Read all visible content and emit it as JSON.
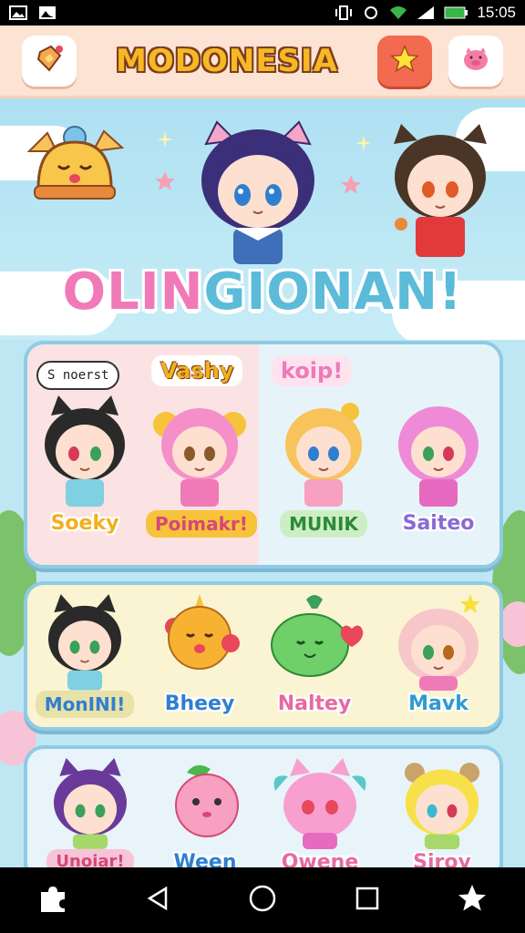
{
  "status_bar": {
    "time": "15:05"
  },
  "header": {
    "title": "MODONESIA",
    "left_button_icon": "map-pin-icon",
    "star_button_icon": "star-icon",
    "right_button_icon": "pig-icon"
  },
  "hero": {
    "title_part1": "OLIN",
    "title_part2": "GIONAN!"
  },
  "panel1": {
    "bubble_text": "S noerst",
    "banner_left": "Vashy",
    "banner_right": "koip!",
    "characters": [
      {
        "label": "Soeky"
      },
      {
        "label": "Poimakr!"
      },
      {
        "label": "MUNIK"
      },
      {
        "label": "Saiteo"
      }
    ]
  },
  "panel2": {
    "characters": [
      {
        "label": "MonINI!"
      },
      {
        "label": "Bheey"
      },
      {
        "label": "Naltey"
      },
      {
        "label": "Mavk"
      }
    ]
  },
  "panel3": {
    "characters": [
      {
        "label": "Unoiar!"
      },
      {
        "label": "Ween"
      },
      {
        "label": "Owene"
      },
      {
        "label": "Siroy"
      }
    ]
  },
  "colors": {
    "accent_orange": "#f26a4f",
    "title_yellow": "#f7b825",
    "panel_border": "#8fcbe5"
  }
}
